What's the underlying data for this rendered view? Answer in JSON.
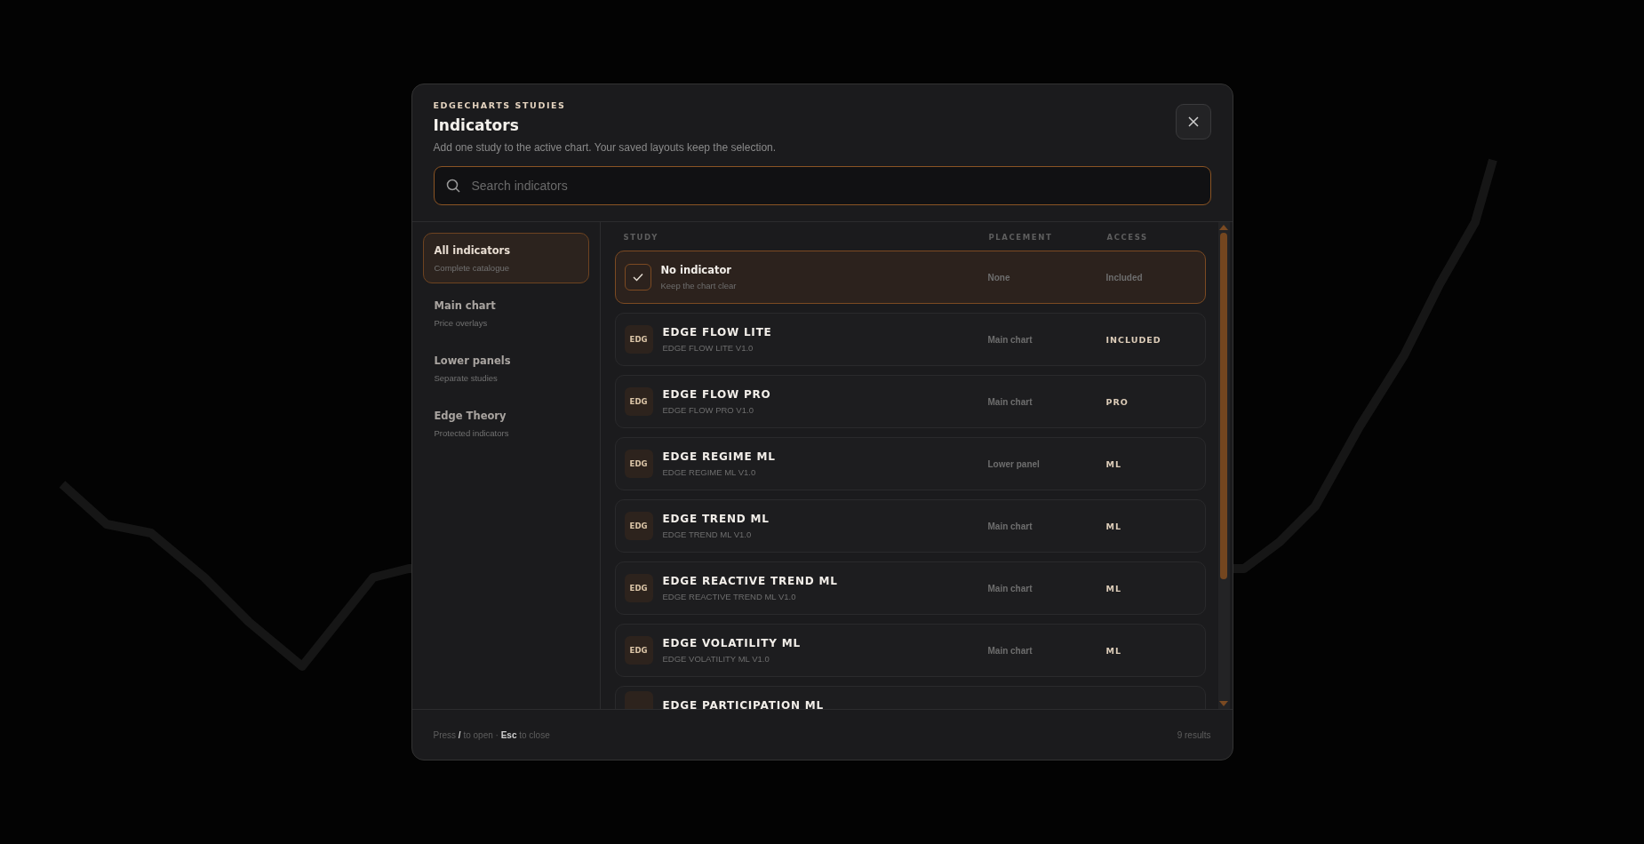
{
  "dialog": {
    "kicker": "EDGECHARTS STUDIES",
    "title": "Indicators",
    "subtitle": "Add one study to the active chart. Your saved layouts keep the selection.",
    "search": {
      "placeholder": "Search indicators"
    }
  },
  "sidebar": {
    "items": [
      {
        "label": "All indicators",
        "caption": "Complete catalogue",
        "selected": true
      },
      {
        "label": "Main chart",
        "caption": "Price overlays",
        "selected": false
      },
      {
        "label": "Lower panels",
        "caption": "Separate studies",
        "selected": false
      },
      {
        "label": "Edge Theory",
        "caption": "Protected indicators",
        "selected": false
      }
    ]
  },
  "table": {
    "columns": [
      "STUDY",
      "PLACEMENT",
      "ACCESS"
    ],
    "rows": [
      {
        "kind": "none",
        "name": "No indicator",
        "detail": "Keep the chart clear",
        "placement": "None",
        "access": "Included",
        "selected": true
      },
      {
        "kind": "study",
        "badge": "EDG",
        "name": "EDGE FLOW LITE",
        "detail": "EDGE FLOW LITE V1.0",
        "placement": "Main chart",
        "access": "INCLUDED",
        "selected": false
      },
      {
        "kind": "study",
        "badge": "EDG",
        "name": "EDGE FLOW PRO",
        "detail": "EDGE FLOW PRO V1.0",
        "placement": "Main chart",
        "access": "PRO",
        "selected": false
      },
      {
        "kind": "study",
        "badge": "EDG",
        "name": "EDGE REGIME ML",
        "detail": "EDGE REGIME ML V1.0",
        "placement": "Lower panel",
        "access": "ML",
        "selected": false
      },
      {
        "kind": "study",
        "badge": "EDG",
        "name": "EDGE TREND ML",
        "detail": "EDGE TREND ML V1.0",
        "placement": "Main chart",
        "access": "ML",
        "selected": false
      },
      {
        "kind": "study",
        "badge": "EDG",
        "name": "EDGE REACTIVE TREND ML",
        "detail": "EDGE REACTIVE TREND ML V1.0",
        "placement": "Main chart",
        "access": "ML",
        "selected": false
      },
      {
        "kind": "study",
        "badge": "EDG",
        "name": "EDGE VOLATILITY ML",
        "detail": "EDGE VOLATILITY ML V1.0",
        "placement": "Main chart",
        "access": "ML",
        "selected": false
      },
      {
        "kind": "cut",
        "name": "EDGE PARTICIPATION ML",
        "selected": false
      }
    ]
  },
  "footer": {
    "hint": "Press **/** to open · **Esc** to close",
    "count": "9 results"
  }
}
